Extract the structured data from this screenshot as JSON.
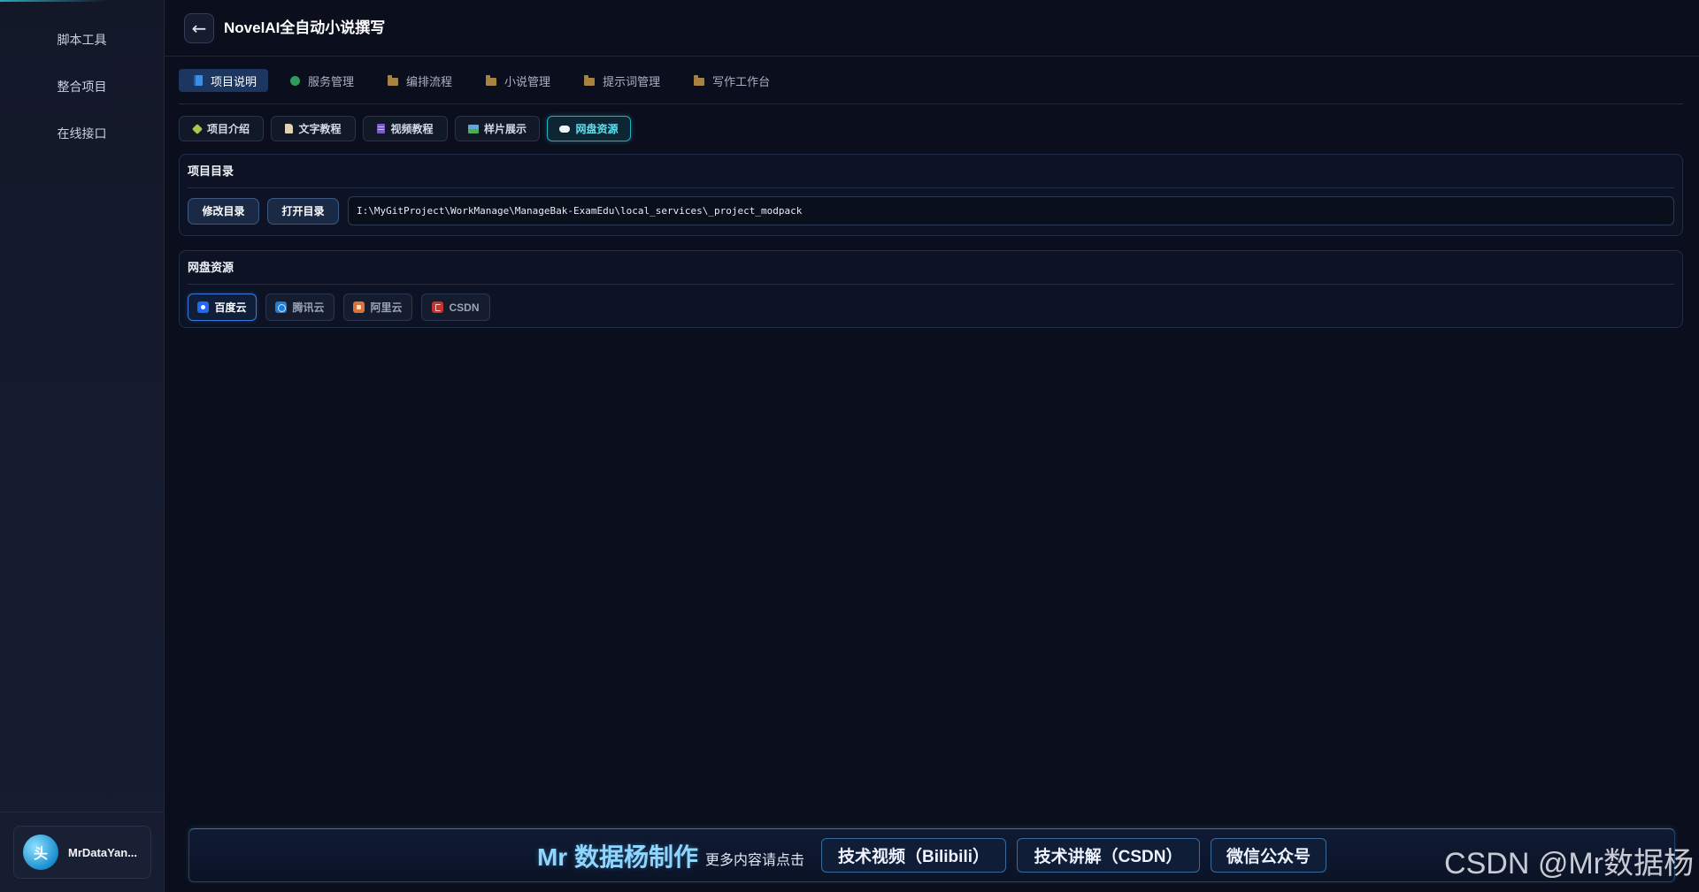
{
  "sidebar": {
    "items": [
      {
        "label": "脚本工具"
      },
      {
        "label": "整合项目"
      },
      {
        "label": "在线接口"
      }
    ],
    "user": {
      "avatar_text": "头",
      "name": "MrDataYan..."
    }
  },
  "header": {
    "back_icon": "arrow-left-icon",
    "back_glyph": "←",
    "title": "NovelAI全自动小说撰写"
  },
  "tabs": [
    {
      "label": "项目说明",
      "icon": "book-icon",
      "active": true
    },
    {
      "label": "服务管理",
      "icon": "green-dot-icon"
    },
    {
      "label": "编排流程",
      "icon": "folder-icon"
    },
    {
      "label": "小说管理",
      "icon": "folder-icon"
    },
    {
      "label": "提示词管理",
      "icon": "folder-icon"
    },
    {
      "label": "写作工作台",
      "icon": "folder-icon"
    }
  ],
  "subtabs": [
    {
      "label": "项目介绍",
      "icon": "puzzle-icon"
    },
    {
      "label": "文字教程",
      "icon": "page-icon"
    },
    {
      "label": "视频教程",
      "icon": "video-icon"
    },
    {
      "label": "样片展示",
      "icon": "picture-icon"
    },
    {
      "label": "网盘资源",
      "icon": "cloud-icon",
      "active": true
    }
  ],
  "project_dir": {
    "title": "项目目录",
    "edit_label": "修改目录",
    "open_label": "打开目录",
    "path": "I:\\MyGitProject\\WorkManage\\ManageBak-ExamEdu\\local_services\\_project_modpack"
  },
  "cloud": {
    "title": "网盘资源",
    "items": [
      {
        "label": "百度云",
        "icon": "baidu-icon",
        "active": true
      },
      {
        "label": "腾讯云",
        "icon": "tencent-cloud-icon"
      },
      {
        "label": "阿里云",
        "icon": "aliyun-icon"
      },
      {
        "label": "CSDN",
        "icon": "csdn-icon"
      }
    ]
  },
  "footer": {
    "brand": "Mr 数据杨制作",
    "more": "更多内容请点击",
    "links": [
      {
        "label": "技术视频（Bilibili）"
      },
      {
        "label": "技术讲解（CSDN）"
      },
      {
        "label": "微信公众号"
      }
    ]
  },
  "watermark": "CSDN @Mr数据杨",
  "colors": {
    "teal": "#5fe0f0",
    "tab-active": "#1c3660",
    "brand": "#8fd6ff",
    "baidu": "#2468f2",
    "tencent": "#1d7fd8",
    "aliyun": "#d9733a",
    "csdn": "#c8322f",
    "dot": "#2e9d5a",
    "folder": "#a68340"
  }
}
